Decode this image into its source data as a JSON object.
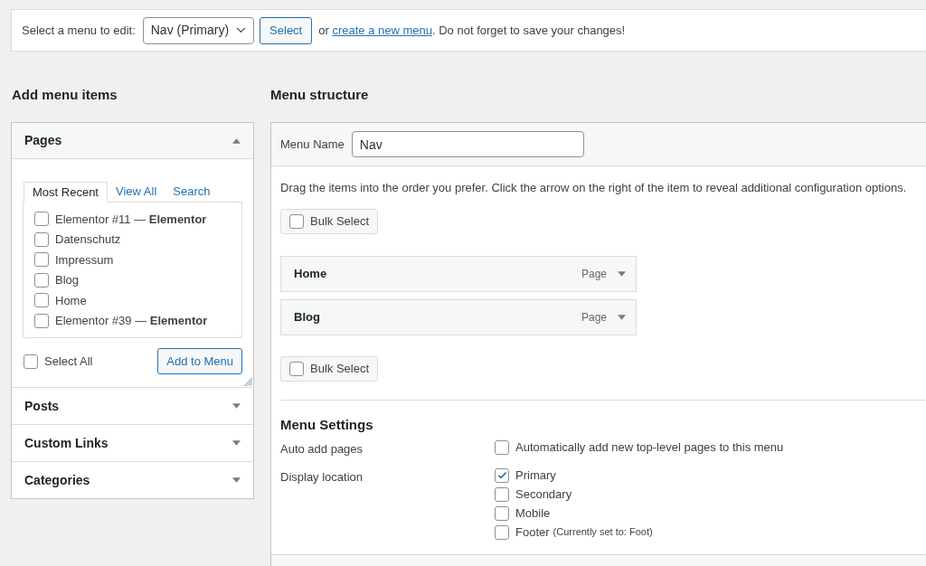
{
  "top_bar": {
    "label": "Select a menu to edit:",
    "menu_select": "Nav (Primary)",
    "select_button": "Select",
    "or_text": "or",
    "create_link": "create a new menu",
    "after_text": ". Do not forget to save your changes!"
  },
  "add_items": {
    "heading": "Add menu items",
    "sections": [
      {
        "title": "Pages",
        "expanded": true,
        "tabs": [
          {
            "label": "Most Recent",
            "selected": true
          },
          {
            "label": "View All",
            "selected": false
          },
          {
            "label": "Search",
            "selected": false
          }
        ],
        "items": [
          {
            "label": "Elementor #11 — **Elementor**",
            "checked": false
          },
          {
            "label": "Datenschutz",
            "checked": false
          },
          {
            "label": "Impressum",
            "checked": false
          },
          {
            "label": "Blog",
            "checked": false
          },
          {
            "label": "Home",
            "checked": false
          },
          {
            "label": "Elementor #39 — **Elementor**",
            "checked": false
          }
        ],
        "select_all": {
          "label": "Select All",
          "checked": false
        },
        "add_button": "Add to Menu"
      },
      {
        "title": "Posts",
        "expanded": false
      },
      {
        "title": "Custom Links",
        "expanded": false
      },
      {
        "title": "Categories",
        "expanded": false
      }
    ]
  },
  "structure": {
    "heading": "Menu structure",
    "menu_name_label": "Menu Name",
    "menu_name": "Nav",
    "instructions": "Drag the items into the order you prefer. Click the arrow on the right of the item to reveal additional configuration options.",
    "bulk_select_top": {
      "label": "Bulk Select",
      "checked": false
    },
    "menu_items": [
      {
        "title": "Home",
        "type": "Page"
      },
      {
        "title": "Blog",
        "type": "Page"
      }
    ],
    "bulk_select_bottom": {
      "label": "Bulk Select",
      "checked": false
    },
    "settings": {
      "heading": "Menu Settings",
      "rows": [
        {
          "label": "Auto add pages",
          "options": [
            {
              "label": "Automatically add new top-level pages to this menu",
              "checked": false
            }
          ]
        },
        {
          "label": "Display location",
          "options": [
            {
              "label": "Primary",
              "checked": true
            },
            {
              "label": "Secondary",
              "checked": false
            },
            {
              "label": "Mobile",
              "checked": false
            },
            {
              "label": "Footer",
              "note": "(Currently set to: Foot)",
              "checked": false
            }
          ]
        }
      ]
    }
  }
}
